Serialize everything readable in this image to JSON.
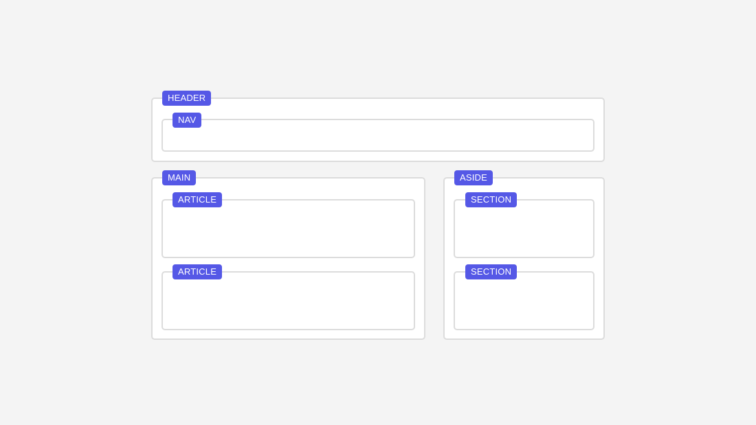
{
  "colors": {
    "background": "#f4f4f4",
    "panel": "#ffffff",
    "border": "#dcdcdc",
    "tag": "#5558e6",
    "tag_text": "#ffffff"
  },
  "layout_blocks": {
    "header": {
      "label": "HEADER"
    },
    "nav": {
      "label": "NAV"
    },
    "main": {
      "label": "MAIN"
    },
    "article_1": {
      "label": "ARTICLE"
    },
    "article_2": {
      "label": "ARTICLE"
    },
    "aside": {
      "label": "ASIDE"
    },
    "section_1": {
      "label": "SECTION"
    },
    "section_2": {
      "label": "SECTION"
    }
  }
}
